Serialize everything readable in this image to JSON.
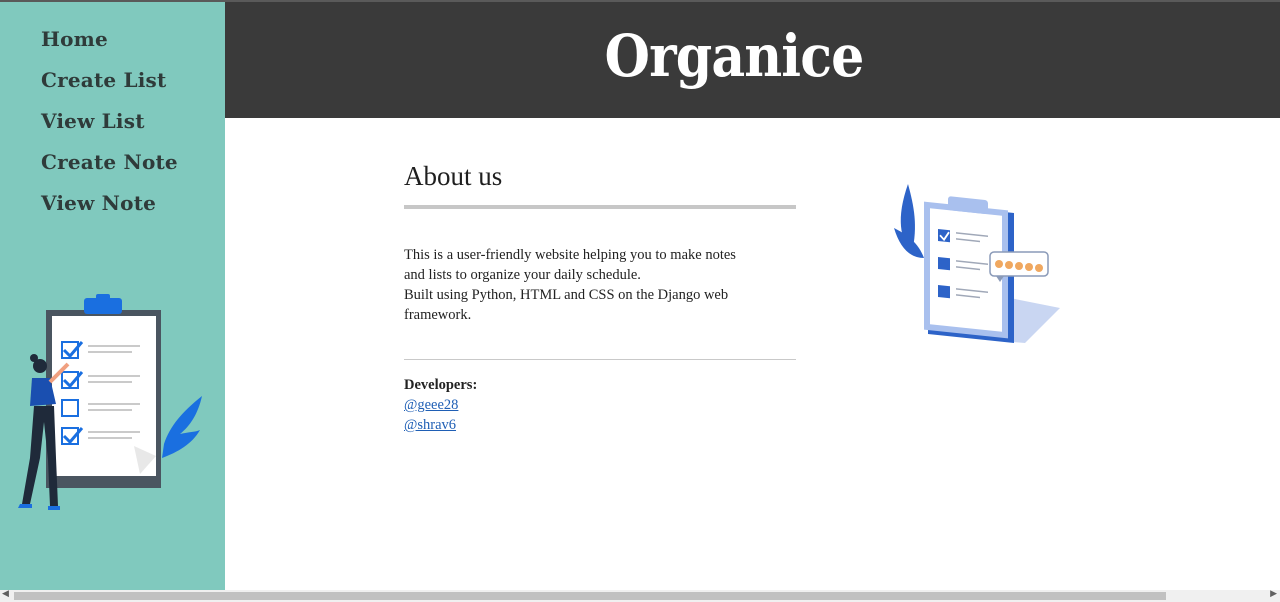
{
  "app": {
    "brand": "Organice"
  },
  "sidebar": {
    "items": [
      {
        "label": "Home"
      },
      {
        "label": "Create List"
      },
      {
        "label": "View List"
      },
      {
        "label": "Create Note"
      },
      {
        "label": "View Note"
      }
    ]
  },
  "about": {
    "title": "About us",
    "description_lines": [
      "This is a user-friendly website helping you to make notes",
      "and lists to organize your daily schedule.",
      "Built using Python, HTML and CSS on the Django web framework."
    ],
    "developers_label": "Developers:",
    "developers": [
      "@geee28",
      "@shrav6"
    ]
  },
  "colors": {
    "sidebar_bg": "#80c9be",
    "header_bg": "#3a3a3a",
    "link": "#1f5fb5",
    "illustration_blue": "#2d63c8"
  },
  "icons": {
    "sidebar_illustration": "checklist-clipboard-person-illustration",
    "main_illustration": "clipboard-rating-stars-illustration"
  }
}
